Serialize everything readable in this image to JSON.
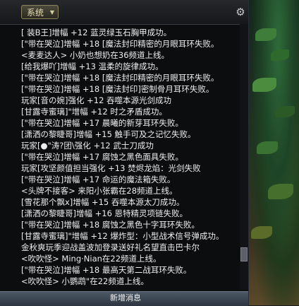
{
  "toolbar": {
    "channel_label": "系统",
    "channel_caret": "▼",
    "settings_icon": "gear-icon",
    "settings_glyph": "⚙"
  },
  "messages": [
    "[ 装B王]增幅 +12 蓝灵绿玉石胸甲成功。",
    "[\"带在哭泣]增幅 +18 [魔法封印精密的月眼耳环失败。",
    "<麦麦达人> 小奶也想奶在36频道上线。",
    "[给我爆吖]增幅 +13 温柔的旋律成功。",
    "[\"带在哭泣]增幅 +18 [魔法封印精密的月眼耳环失败。",
    "[\"带在哭泣]增幅 +18 [魔法封印]密制骨月耳环失败。",
    "玩家[音の婉]强化 +12 吞噬本源光剑成功",
    "[甘露寺蜜璃]\"增幅 +12 时之矛盾成功。",
    "[\"带在哭泣]增幅 +17 晨曦的新芽耳环失败。",
    "[潇洒の黎睫哥]增幅 +15 触手可及之记忆失败。",
    "玩家[●\"涛?团\\强化 +12 武士刀成功",
    "[\"带在哭泣]增幅 +17 腐蚀之黑色面具失败。",
    "玩家[攻坚颜值担当强化 +13 焚烬龙焰：光剑失败",
    "[\"带在哭泣]增幅 +17 命运的魔法箱失败。",
    "<头牌不接客> 来阳小张霸在28频道上线。",
    "[雪花那个飘x]增幅 +15 吞噬本源太刀成功。",
    "[潇洒の黎睫哥]增幅 +16 恩特精灵项链失败。",
    "[\"带在哭泣]增幅 +18 腐蚀之黑色十字耳环失败。",
    "[甘露寺蜜璃]\"增幅 +12 爆炸型：小型战术信号弹成功。",
    "金秋爽玩季迎战盖波加登录送好礼名望直击巴卡尔",
    "<吹吹怪> Ming·Nian在22频道上线。",
    "[\"带在哭泣]增幅 +18 最高天第二战耳环失败。",
    "<吹吹怪> 小鹦鹉\"在22频道上线。"
  ],
  "bottom": {
    "new_messages_label": "新增消息"
  }
}
